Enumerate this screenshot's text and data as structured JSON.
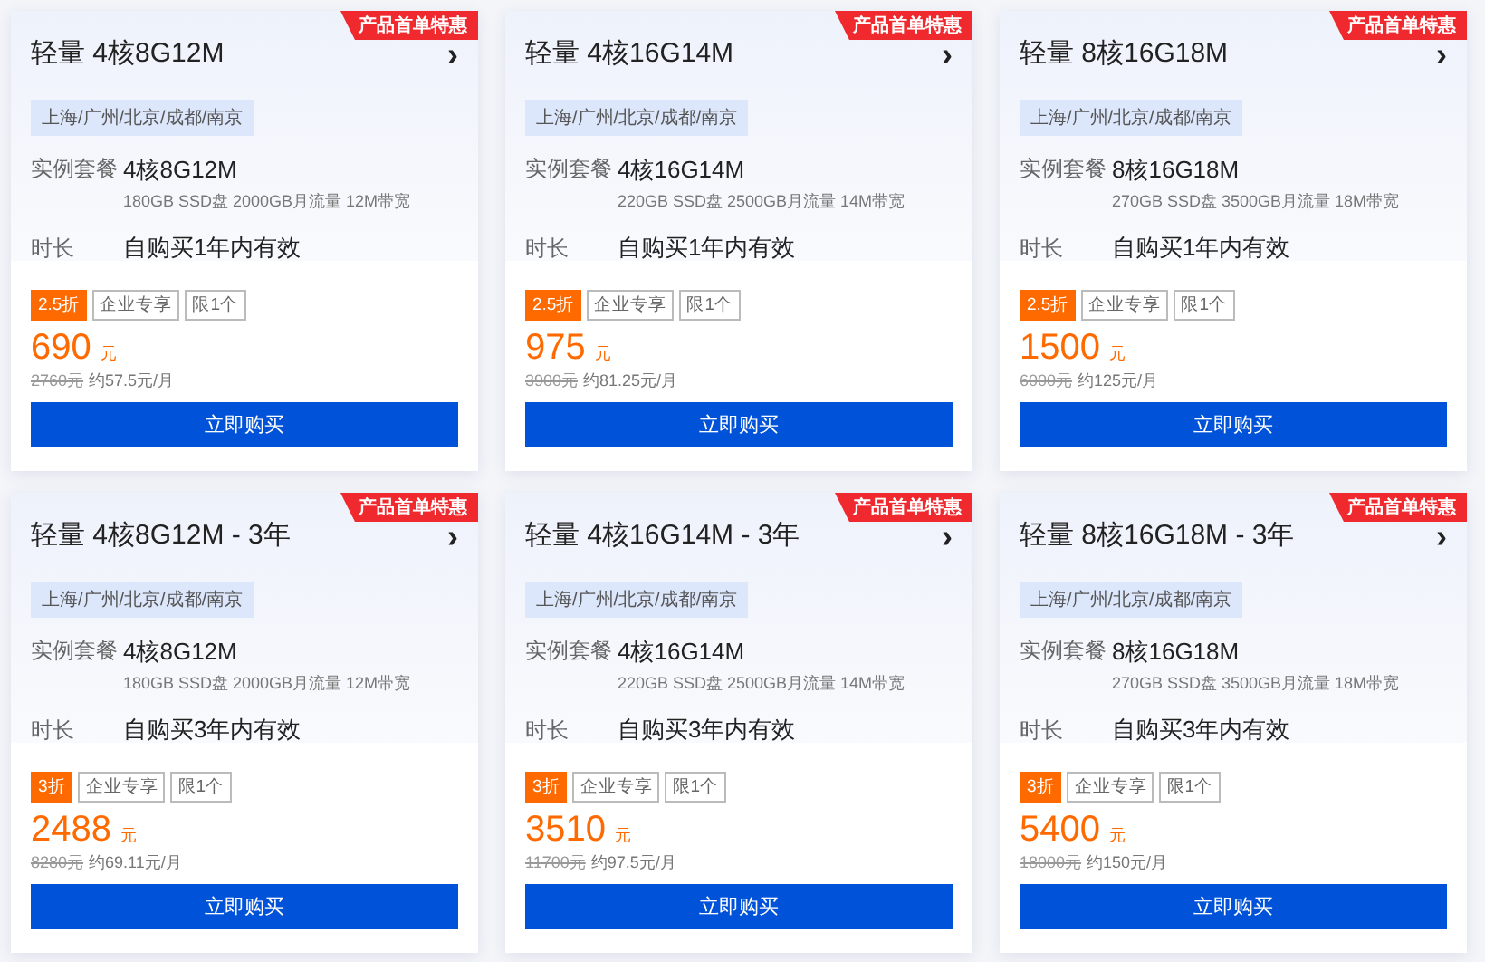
{
  "cards": [
    {
      "ribbon": "产品首单特惠",
      "title": "轻量 4核8G12M",
      "chevron": "›",
      "region": "上海/广州/北京/成都/南京",
      "spec_label": "实例套餐",
      "spec": "4核8G12M",
      "spec_detail": "180GB SSD盘 2000GB月流量 12M带宽",
      "duration_label": "时长",
      "duration": "自购买1年内有效",
      "tags": [
        {
          "text": "2.5折",
          "kind": "discount"
        },
        {
          "text": "企业专享",
          "kind": "outline"
        },
        {
          "text": "限1个",
          "kind": "outline"
        }
      ],
      "price": "690",
      "unit": "元",
      "original_price": "2760元",
      "monthly": "约57.5元/月",
      "button": "立即购买"
    },
    {
      "ribbon": "产品首单特惠",
      "title": "轻量 4核16G14M",
      "chevron": "›",
      "region": "上海/广州/北京/成都/南京",
      "spec_label": "实例套餐",
      "spec": "4核16G14M",
      "spec_detail": "220GB SSD盘 2500GB月流量 14M带宽",
      "duration_label": "时长",
      "duration": "自购买1年内有效",
      "tags": [
        {
          "text": "2.5折",
          "kind": "discount"
        },
        {
          "text": "企业专享",
          "kind": "outline"
        },
        {
          "text": "限1个",
          "kind": "outline"
        }
      ],
      "price": "975",
      "unit": "元",
      "original_price": "3900元",
      "monthly": "约81.25元/月",
      "button": "立即购买"
    },
    {
      "ribbon": "产品首单特惠",
      "title": "轻量 8核16G18M",
      "chevron": "›",
      "region": "上海/广州/北京/成都/南京",
      "spec_label": "实例套餐",
      "spec": "8核16G18M",
      "spec_detail": "270GB SSD盘 3500GB月流量 18M带宽",
      "duration_label": "时长",
      "duration": "自购买1年内有效",
      "tags": [
        {
          "text": "2.5折",
          "kind": "discount"
        },
        {
          "text": "企业专享",
          "kind": "outline"
        },
        {
          "text": "限1个",
          "kind": "outline"
        }
      ],
      "price": "1500",
      "unit": "元",
      "original_price": "6000元",
      "monthly": "约125元/月",
      "button": "立即购买"
    },
    {
      "ribbon": "产品首单特惠",
      "title": "轻量 4核8G12M - 3年",
      "chevron": "›",
      "region": "上海/广州/北京/成都/南京",
      "spec_label": "实例套餐",
      "spec": "4核8G12M",
      "spec_detail": "180GB SSD盘 2000GB月流量 12M带宽",
      "duration_label": "时长",
      "duration": "自购买3年内有效",
      "tags": [
        {
          "text": "3折",
          "kind": "discount"
        },
        {
          "text": "企业专享",
          "kind": "outline"
        },
        {
          "text": "限1个",
          "kind": "outline"
        }
      ],
      "price": "2488",
      "unit": "元",
      "original_price": "8280元",
      "monthly": "约69.11元/月",
      "button": "立即购买"
    },
    {
      "ribbon": "产品首单特惠",
      "title": "轻量 4核16G14M - 3年",
      "chevron": "›",
      "region": "上海/广州/北京/成都/南京",
      "spec_label": "实例套餐",
      "spec": "4核16G14M",
      "spec_detail": "220GB SSD盘 2500GB月流量 14M带宽",
      "duration_label": "时长",
      "duration": "自购买3年内有效",
      "tags": [
        {
          "text": "3折",
          "kind": "discount"
        },
        {
          "text": "企业专享",
          "kind": "outline"
        },
        {
          "text": "限1个",
          "kind": "outline"
        }
      ],
      "price": "3510",
      "unit": "元",
      "original_price": "11700元",
      "monthly": "约97.5元/月",
      "button": "立即购买"
    },
    {
      "ribbon": "产品首单特惠",
      "title": "轻量 8核16G18M - 3年",
      "chevron": "›",
      "region": "上海/广州/北京/成都/南京",
      "spec_label": "实例套餐",
      "spec": "8核16G18M",
      "spec_detail": "270GB SSD盘 3500GB月流量 18M带宽",
      "duration_label": "时长",
      "duration": "自购买3年内有效",
      "tags": [
        {
          "text": "3折",
          "kind": "discount"
        },
        {
          "text": "企业专享",
          "kind": "outline"
        },
        {
          "text": "限1个",
          "kind": "outline"
        }
      ],
      "price": "5400",
      "unit": "元",
      "original_price": "18000元",
      "monthly": "约150元/月",
      "button": "立即购买"
    }
  ]
}
